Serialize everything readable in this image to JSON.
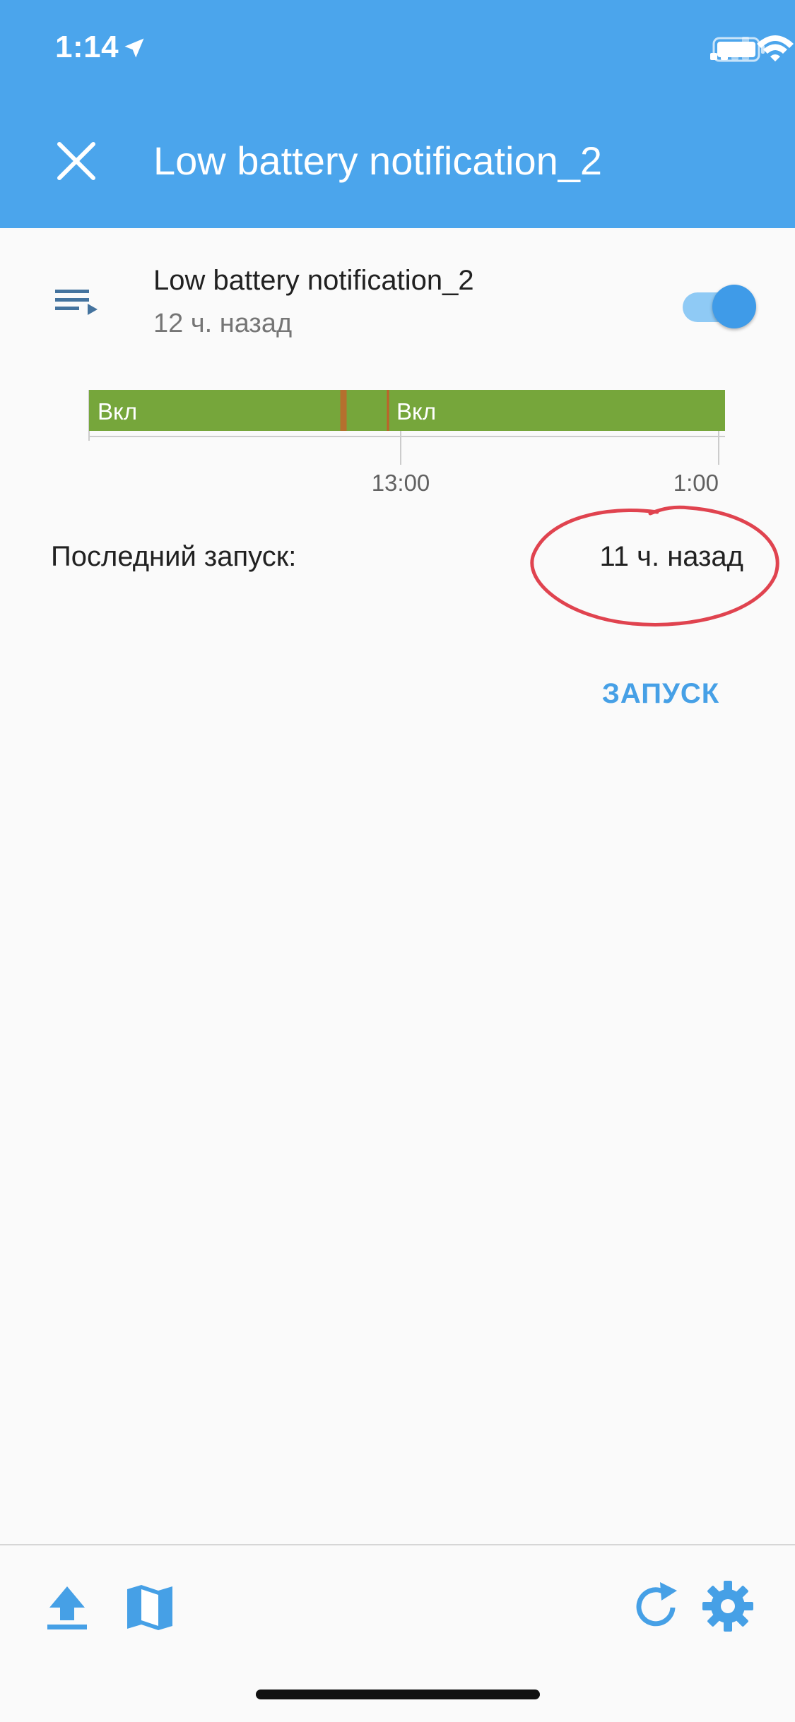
{
  "status_bar": {
    "time": "1:14",
    "location_icon": "location-arrow-icon",
    "signal_icon": "cellular-signal-icon",
    "wifi_icon": "wifi-icon",
    "battery_icon": "battery-icon"
  },
  "app_bar": {
    "close_icon": "close-icon",
    "title": "Low battery notification_2"
  },
  "automation": {
    "icon": "playlist-play-icon",
    "name": "Low battery notification_2",
    "last_changed": "12 ч. назад",
    "enabled": true
  },
  "timeline": {
    "segments": [
      {
        "label": "Вкл",
        "start": 0.0,
        "end": 0.395,
        "state": "on"
      },
      {
        "label": "",
        "start": 0.395,
        "end": 0.405,
        "state": "changed"
      },
      {
        "label": "",
        "start": 0.405,
        "end": 0.47,
        "state": "on"
      },
      {
        "label": "Вкл",
        "start": 0.47,
        "end": 1.0,
        "state": "on"
      }
    ],
    "ticks": [
      {
        "label": "13:00",
        "position": 0.49
      },
      {
        "label": "1:00",
        "position": 0.99
      }
    ]
  },
  "last_run": {
    "label": "Последний запуск:",
    "value": "11 ч. назад"
  },
  "actions": {
    "run_label": "ЗАПУСК"
  },
  "toolbar": {
    "upload_icon": "upload-icon",
    "map_icon": "map-icon",
    "refresh_icon": "refresh-icon",
    "settings_icon": "gear-icon"
  },
  "colors": {
    "primary": "#4ba5ec",
    "accent": "#46a0e6",
    "timeline_on": "#76a63b",
    "annotation": "#e0434f"
  }
}
